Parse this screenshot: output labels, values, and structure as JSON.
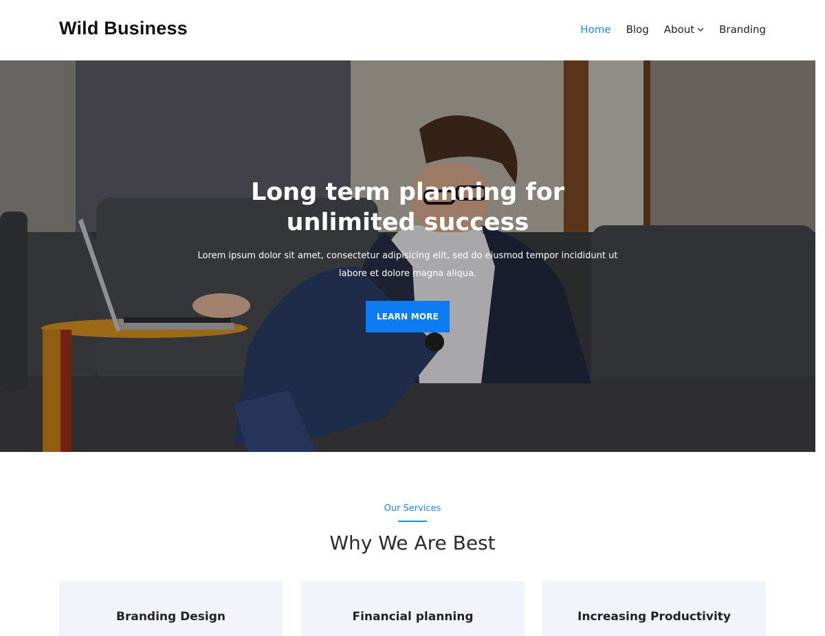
{
  "header": {
    "site_title": "Wild Business",
    "nav": [
      {
        "label": "Home",
        "active": true
      },
      {
        "label": "Blog",
        "active": false
      },
      {
        "label": "About",
        "active": false,
        "has_dropdown": true
      },
      {
        "label": "Branding",
        "active": false
      }
    ]
  },
  "hero": {
    "title": "Long term planning for unlimited success",
    "text": "Lorem ipsum dolor sit amet, consectetur adipisicing elit, sed do eiusmod tempor incididunt ut labore et dolore magna aliqua.",
    "button_label": "LEARN MORE"
  },
  "services": {
    "eyebrow": "Our Services",
    "title": "Why We Are Best",
    "cards": [
      {
        "title": "Branding Design"
      },
      {
        "title": "Financial planning"
      },
      {
        "title": "Increasing Productivity"
      }
    ]
  },
  "colors": {
    "accent": "#1e88e5",
    "button": "#0d7cf2",
    "card_bg": "#f1f5fb"
  }
}
